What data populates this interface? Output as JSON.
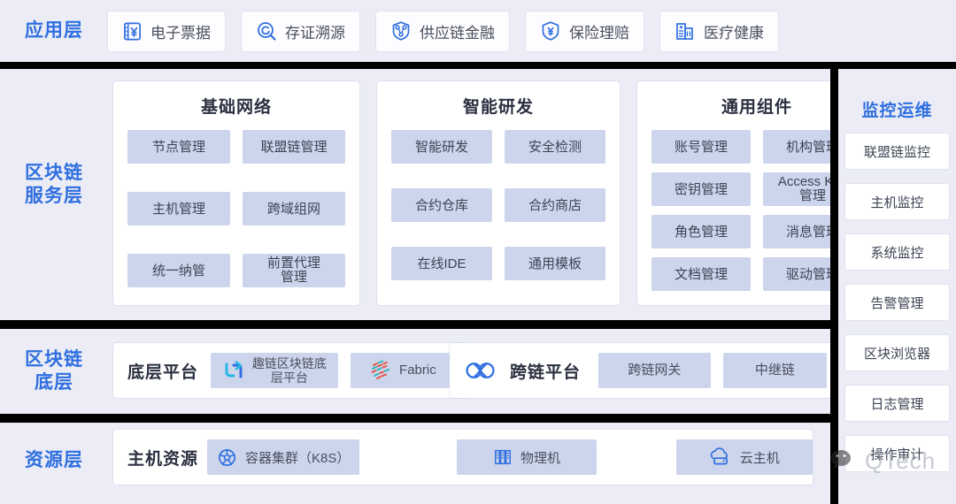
{
  "layers": {
    "application": {
      "label": "应用层",
      "items": [
        {
          "label": "电子票据",
          "icon": "bill-yuan-icon"
        },
        {
          "label": "存证溯源",
          "icon": "magnifier-trace-icon"
        },
        {
          "label": "供应链金融",
          "icon": "supply-chain-node-icon"
        },
        {
          "label": "保险理赔",
          "icon": "shield-yuan-icon"
        },
        {
          "label": "医疗健康",
          "icon": "hospital-building-icon"
        }
      ]
    },
    "service": {
      "label": "区块链\n服务层",
      "cards": [
        {
          "title": "基础网络",
          "tiles": [
            "节点管理",
            "联盟链管理",
            "主机管理",
            "跨域组网",
            "统一纳管",
            "前置代理\n管理"
          ]
        },
        {
          "title": "智能研发",
          "tiles": [
            "智能研发",
            "安全检测",
            "合约仓库",
            "合约商店",
            "在线IDE",
            "通用模板"
          ]
        },
        {
          "title": "通用组件",
          "tiles": [
            "账号管理",
            "机构管理",
            "密钥管理",
            "Access Key\n管理",
            "角色管理",
            "消息管理",
            "文档管理",
            "驱动管理"
          ]
        }
      ]
    },
    "bottom": {
      "label": "区块链\n底层",
      "groups": [
        {
          "title": "底层平台",
          "chips": [
            {
              "label": "趣链区块链底\n层平台",
              "icon": "hyperchain-logo-icon"
            },
            {
              "label": "Fabric",
              "icon": "fabric-logo-icon"
            }
          ]
        },
        {
          "title": "跨链平台",
          "title_icon": "crosschain-logo-icon",
          "chips": [
            {
              "label": "跨链网关",
              "icon": ""
            },
            {
              "label": "中继链",
              "icon": ""
            }
          ]
        }
      ]
    },
    "resource": {
      "label": "资源层",
      "group_title": "主机资源",
      "items": [
        {
          "label": "容器集群（K8S）",
          "icon": "kubernetes-icon"
        },
        {
          "label": "物理机",
          "icon": "server-rack-icon"
        },
        {
          "label": "云主机",
          "icon": "cloud-host-icon"
        }
      ]
    },
    "monitoring": {
      "label": "监控运维",
      "items": [
        "联盟链监控",
        "主机监控",
        "系统监控",
        "告警管理",
        "区块浏览器",
        "日志管理",
        "操作审计"
      ]
    }
  },
  "watermark": {
    "text": "QTech",
    "icon": "wechat-icon"
  },
  "colors": {
    "accent_blue": "#2f6fe0",
    "tile_blue": "#ccd5ec",
    "background": "#ebecf5",
    "separator": "#000000",
    "card_white": "#ffffff"
  }
}
